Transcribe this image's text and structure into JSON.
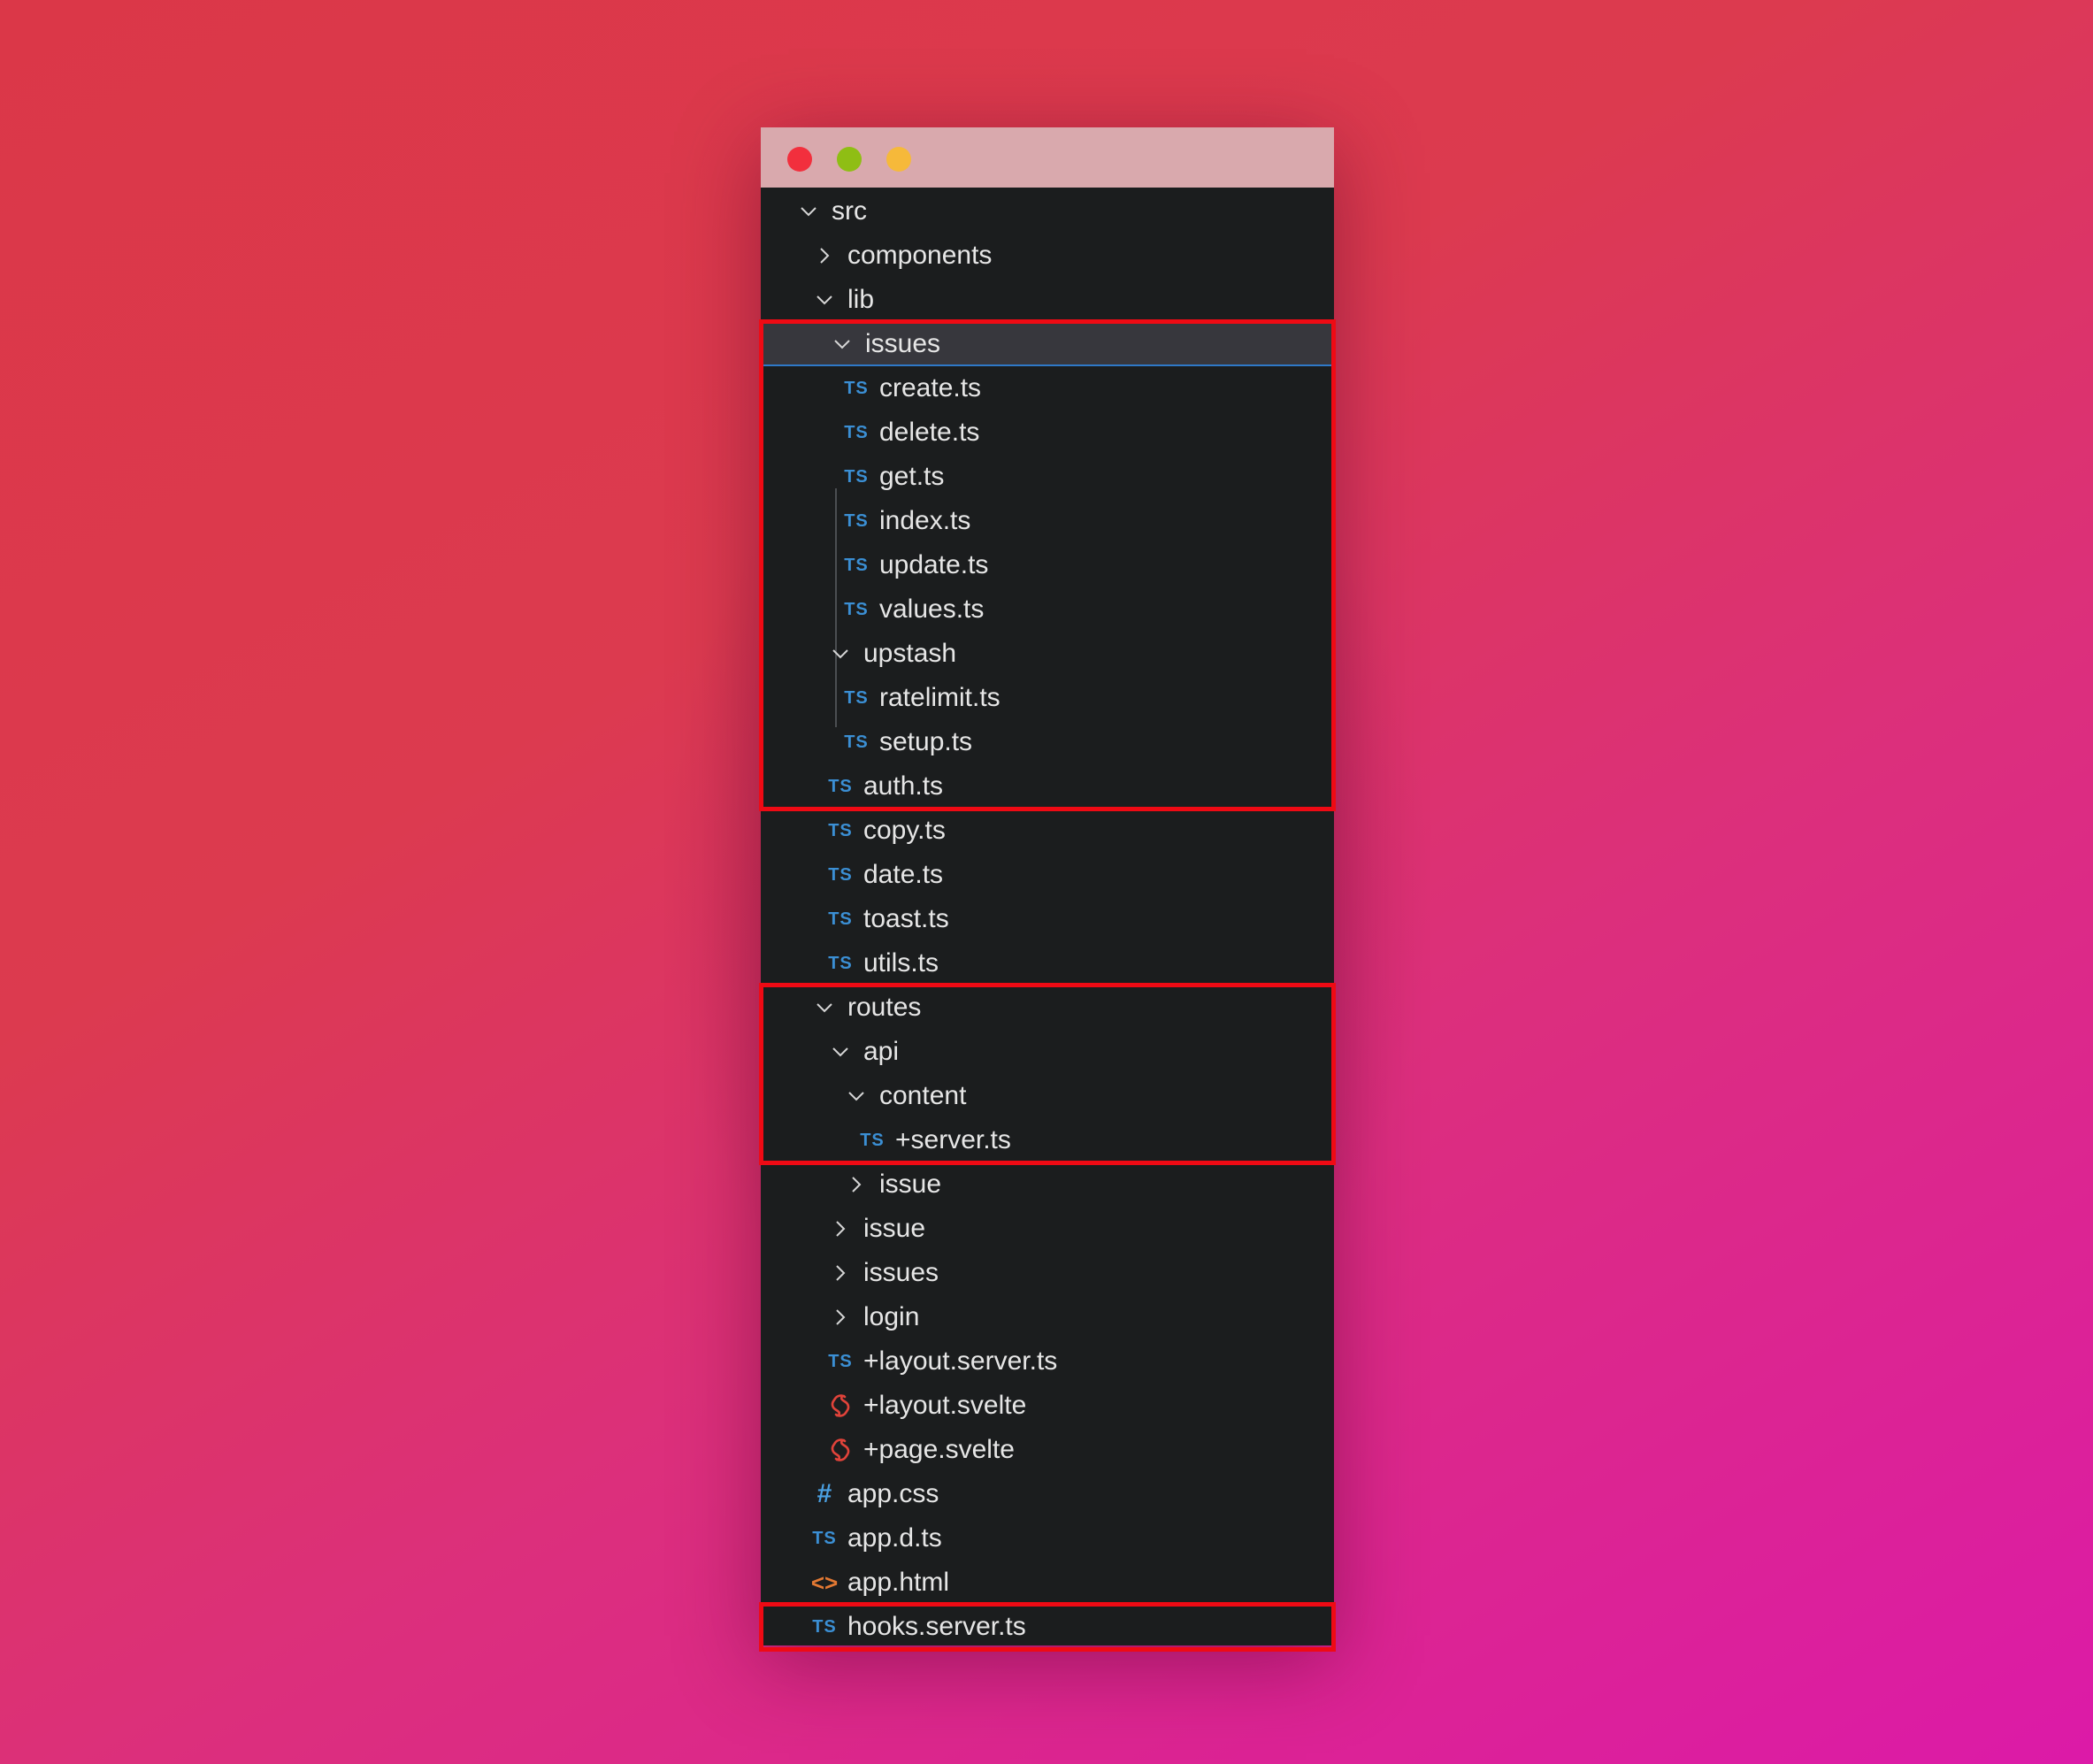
{
  "window": {
    "controls": [
      "close",
      "minimize",
      "maximize"
    ],
    "colors": {
      "close": "#f22f3d",
      "minimize": "#8fbe14",
      "maximize": "#f6b93a",
      "highlight": "#ef0a14",
      "ts_icon": "#3b8fd4",
      "svelte_icon": "#e0433a"
    }
  },
  "tree": [
    {
      "label": "src",
      "kind": "folder",
      "expanded": true,
      "depth": 0
    },
    {
      "label": "components",
      "kind": "folder",
      "expanded": false,
      "depth": 1
    },
    {
      "label": "lib",
      "kind": "folder",
      "expanded": true,
      "depth": 1
    },
    {
      "label": "issues",
      "kind": "folder",
      "expanded": true,
      "depth": 2,
      "selected": true
    },
    {
      "label": "create.ts",
      "kind": "ts",
      "depth": 3
    },
    {
      "label": "delete.ts",
      "kind": "ts",
      "depth": 3
    },
    {
      "label": "get.ts",
      "kind": "ts",
      "depth": 3
    },
    {
      "label": "index.ts",
      "kind": "ts",
      "depth": 3
    },
    {
      "label": "update.ts",
      "kind": "ts",
      "depth": 3
    },
    {
      "label": "values.ts",
      "kind": "ts",
      "depth": 3
    },
    {
      "label": "upstash",
      "kind": "folder",
      "expanded": true,
      "depth": 2
    },
    {
      "label": "ratelimit.ts",
      "kind": "ts",
      "depth": 3
    },
    {
      "label": "setup.ts",
      "kind": "ts",
      "depth": 3
    },
    {
      "label": "auth.ts",
      "kind": "ts",
      "depth": 2
    },
    {
      "label": "copy.ts",
      "kind": "ts",
      "depth": 2
    },
    {
      "label": "date.ts",
      "kind": "ts",
      "depth": 2
    },
    {
      "label": "toast.ts",
      "kind": "ts",
      "depth": 2
    },
    {
      "label": "utils.ts",
      "kind": "ts",
      "depth": 2
    },
    {
      "label": "routes",
      "kind": "folder",
      "expanded": true,
      "depth": 1
    },
    {
      "label": "api",
      "kind": "folder",
      "expanded": true,
      "depth": 2
    },
    {
      "label": "content",
      "kind": "folder",
      "expanded": true,
      "depth": 3
    },
    {
      "label": "+server.ts",
      "kind": "ts",
      "depth": 4
    },
    {
      "label": "issue",
      "kind": "folder",
      "expanded": false,
      "depth": 3
    },
    {
      "label": "issue",
      "kind": "folder",
      "expanded": false,
      "depth": 2
    },
    {
      "label": "issues",
      "kind": "folder",
      "expanded": false,
      "depth": 2
    },
    {
      "label": "login",
      "kind": "folder",
      "expanded": false,
      "depth": 2
    },
    {
      "label": "+layout.server.ts",
      "kind": "ts",
      "depth": 2
    },
    {
      "label": "+layout.svelte",
      "kind": "svelte",
      "depth": 2
    },
    {
      "label": "+page.svelte",
      "kind": "svelte",
      "depth": 2
    },
    {
      "label": "app.css",
      "kind": "css",
      "depth": 1
    },
    {
      "label": "app.d.ts",
      "kind": "ts",
      "depth": 1
    },
    {
      "label": "app.html",
      "kind": "html",
      "depth": 1
    },
    {
      "label": "hooks.server.ts",
      "kind": "ts",
      "depth": 1
    }
  ],
  "icon_glyphs": {
    "ts": "TS",
    "css": "#",
    "html": "<>"
  },
  "highlights": [
    {
      "name": "lib-issues-block",
      "first": "issues",
      "last": "auth.ts"
    },
    {
      "name": "routes-api-content-block",
      "first": "routes",
      "last": "+server.ts"
    },
    {
      "name": "hooks-server-block",
      "first": "hooks.server.ts",
      "last": "hooks.server.ts"
    }
  ]
}
